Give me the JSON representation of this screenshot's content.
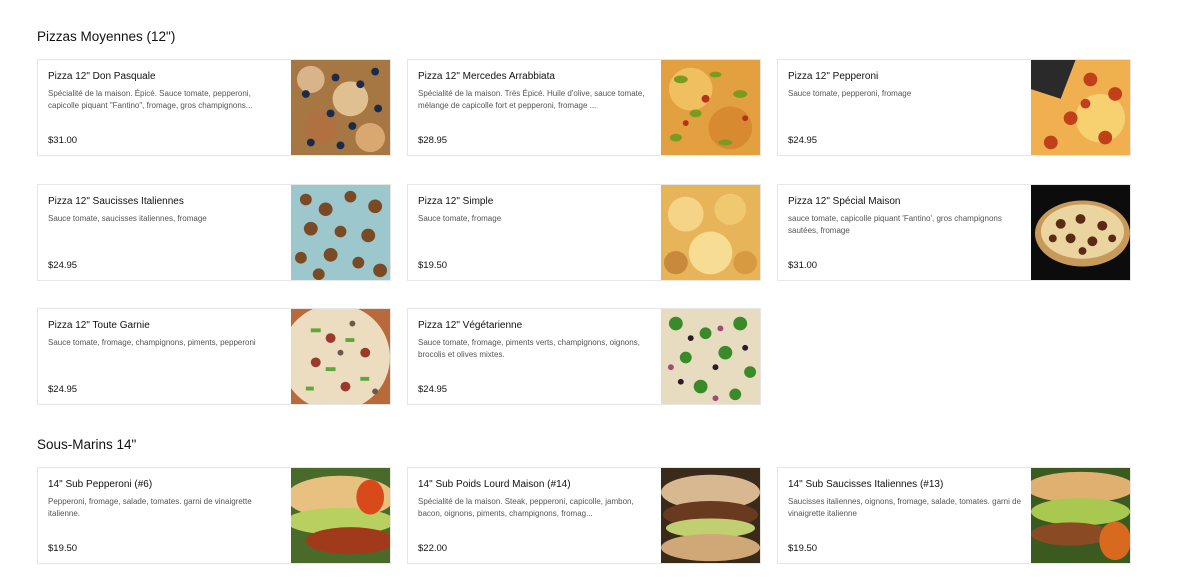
{
  "sections": [
    {
      "title": "Pizzas Moyennes (12\")",
      "items": [
        {
          "name": "Pizza 12\" Don Pasquale",
          "description": "Spécialité de la maison. Épicé. Sauce tomate, pepperoni, capicolle piquant \"Fantino\", fromage, gros champignons...",
          "price": "$31.00",
          "image": "pizza-olives-photo"
        },
        {
          "name": "Pizza 12\" Mercedes Arrabbiata",
          "description": "Spécialité de la maison. Très Épicé. Huile d'olive, sauce tomate, mélange de capicolle fort et pepperoni, fromage ...",
          "price": "$28.95",
          "image": "pizza-peppers-photo"
        },
        {
          "name": "Pizza 12\" Pepperoni",
          "description": "Sauce tomate, pepperoni, fromage",
          "price": "$24.95",
          "image": "pizza-pepperoni-photo"
        },
        {
          "name": "Pizza 12\" Saucisses Italiennes",
          "description": "Sauce tomate, saucisses italiennes, fromage",
          "price": "$24.95",
          "image": "pizza-sausage-photo"
        },
        {
          "name": "Pizza 12\" Simple",
          "description": "Sauce tomate, fromage",
          "price": "$19.50",
          "image": "pizza-cheese-photo"
        },
        {
          "name": "Pizza 12\" Spécial Maison",
          "description": "sauce tomate, capicolle piquant 'Fantino', gros champignons sautées, fromage",
          "price": "$31.00",
          "image": "pizza-special-photo"
        },
        {
          "name": "Pizza 12\" Toute Garnie",
          "description": "Sauce tomate, fromage, champignons, piments, pepperoni",
          "price": "$24.95",
          "image": "pizza-all-dressed-photo"
        },
        {
          "name": "Pizza 12\" Végétarienne",
          "description": "Sauce tomate, fromage, piments verts, champignons, oignons, brocolis et olives mixtes.",
          "price": "$24.95",
          "image": "pizza-vegetarian-photo"
        }
      ]
    },
    {
      "title": "Sous-Marins 14\"",
      "items": [
        {
          "name": "14\" Sub Pepperoni (#6)",
          "description": "Pepperoni, fromage, salade, tomates. garni de vinaigrette italienne.",
          "price": "$19.50",
          "image": "sub-pepperoni-photo"
        },
        {
          "name": "14\" Sub Poids Lourd Maison (#14)",
          "description": "Spécialité de la maison. Steak, pepperoni, capicolle, jambon, bacon, oignons, piments, champignons, fromag...",
          "price": "$22.00",
          "image": "sub-heavyweight-photo"
        },
        {
          "name": "14\" Sub Saucisses Italiennes (#13)",
          "description": "Saucisses italiennes, oignons, fromage, salade, tomates. garni de vinaigrette italienne",
          "price": "$19.50",
          "image": "sub-sausage-photo"
        }
      ]
    }
  ]
}
